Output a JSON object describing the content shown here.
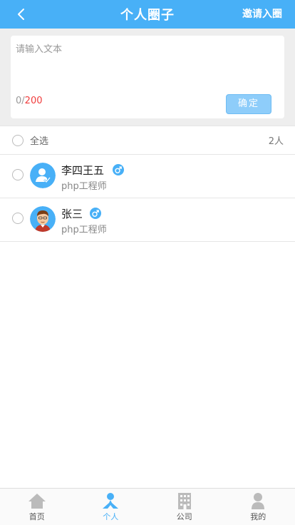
{
  "header": {
    "title": "个人圈子",
    "invite_label": "邀请入圈"
  },
  "composer": {
    "placeholder": "请输入文本",
    "count_current": "0",
    "count_separator": "/",
    "count_max": "200",
    "confirm_label": "确定"
  },
  "select_all": {
    "label": "全选",
    "count": "2人"
  },
  "members": [
    {
      "name": "李四王五",
      "role": "php工程师",
      "gender_icon": "male-icon",
      "avatar_icon": "default-user-avatar"
    },
    {
      "name": "张三",
      "role": "php工程师",
      "gender_icon": "male-icon",
      "avatar_icon": "cartoon-man-avatar"
    }
  ],
  "tabs": [
    {
      "label": "首页",
      "icon": "home-icon",
      "active": false
    },
    {
      "label": "个人",
      "icon": "person-icon",
      "active": true
    },
    {
      "label": "公司",
      "icon": "building-icon",
      "active": false
    },
    {
      "label": "我的",
      "icon": "user-icon",
      "active": false
    }
  ],
  "colors": {
    "primary": "#48b0f7",
    "confirm_button": "#8ecdfa",
    "count_max": "#f03c3c",
    "tab_inactive": "#bbbbbb"
  }
}
